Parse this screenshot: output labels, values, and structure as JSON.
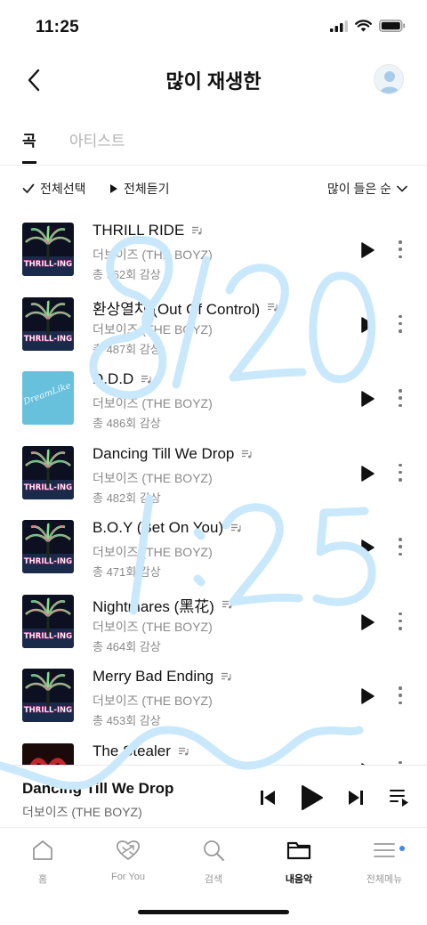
{
  "status_bar": {
    "time": "11:25"
  },
  "header": {
    "title": "많이 재생한"
  },
  "tabs": [
    {
      "label": "곡",
      "active": true
    },
    {
      "label": "아티스트",
      "active": false
    }
  ],
  "toolbar": {
    "select_all": "전체선택",
    "play_all": "전체듣기",
    "sort": "많이 들은 순"
  },
  "songs": [
    {
      "title": "THRILL RIDE",
      "artist": "더보이즈 (THE BOYZ)",
      "plays": "총 962회 감상",
      "cover": "thrill-ing"
    },
    {
      "title": "환상열차 (Out Of Control)",
      "artist": "더보이즈 (THE BOYZ)",
      "plays": "총 487회 감상",
      "cover": "thrill-ing"
    },
    {
      "title": "D.D.D",
      "artist": "더보이즈 (THE BOYZ)",
      "plays": "총 486회 감상",
      "cover": "dreamlike"
    },
    {
      "title": "Dancing Till We Drop",
      "artist": "더보이즈 (THE BOYZ)",
      "plays": "총 482회 감상",
      "cover": "thrill-ing"
    },
    {
      "title": "B.O.Y (Bet On You)",
      "artist": "더보이즈 (THE BOYZ)",
      "plays": "총 471회 감상",
      "cover": "thrill-ing"
    },
    {
      "title": "Nightmares (黑花)",
      "artist": "더보이즈 (THE BOYZ)",
      "plays": "총 464회 감상",
      "cover": "thrill-ing"
    },
    {
      "title": "Merry Bad Ending",
      "artist": "더보이즈 (THE BOYZ)",
      "plays": "총 453회 감상",
      "cover": "thrill-ing"
    },
    {
      "title": "The Stealer",
      "artist": "",
      "plays": "",
      "cover": "stealer"
    }
  ],
  "cover_text": {
    "thrill-ing": "THRILL-ING",
    "dreamlike": "DreamLike"
  },
  "now_playing": {
    "title": "Dancing Till We Drop",
    "artist": "더보이즈 (THE BOYZ)"
  },
  "bottom_nav": [
    {
      "label": "홈",
      "icon": "home-icon",
      "active": false
    },
    {
      "label": "For You",
      "icon": "heart-shuffle-icon",
      "active": false
    },
    {
      "label": "검색",
      "icon": "search-icon",
      "active": false
    },
    {
      "label": "내음악",
      "icon": "folder-icon",
      "active": true
    },
    {
      "label": "전체메뉴",
      "icon": "menu-icon",
      "active": false
    }
  ],
  "colors": {
    "scribble": "#c9e8fb",
    "notification_dot": "#3d8bf2",
    "dreamlike_cover": "#5bb7d6"
  }
}
